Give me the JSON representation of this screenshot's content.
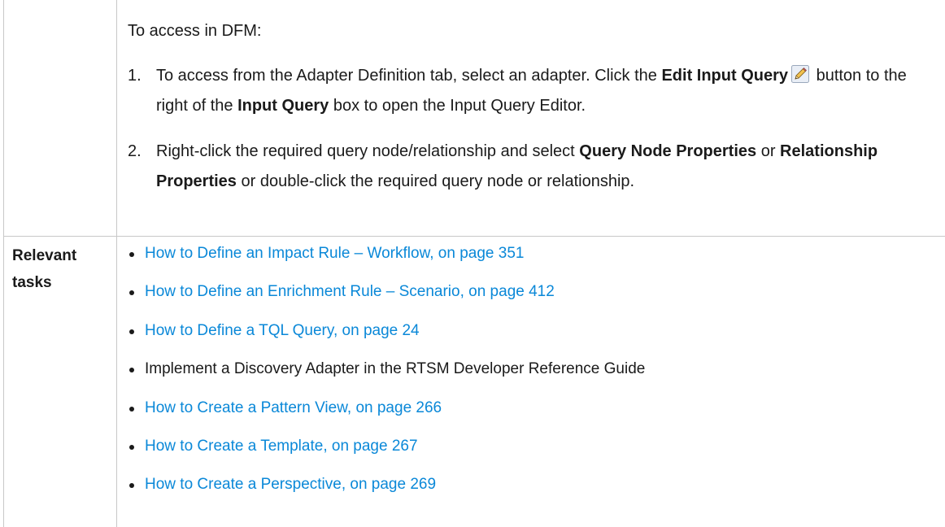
{
  "row_access": {
    "intro": "To access in DFM:",
    "steps": [
      {
        "number": "1.",
        "part1": "To access from the Adapter Definition tab, select an adapter. Click the ",
        "bold1": "Edit Input Query",
        "part2": " button to the right of the ",
        "bold2": "Input Query",
        "part3": " box to open the Input Query Editor."
      },
      {
        "number": "2.",
        "part1": "Right-click the required query node/relationship and select ",
        "bold1": "Query Node Properties",
        "part2": " or ",
        "bold2": "Relationship Properties",
        "part3": " or double-click the required query node or relationship."
      }
    ],
    "icon": "pencil-icon"
  },
  "row_tasks": {
    "label_line1": "Relevant",
    "label_line2": "tasks",
    "items": [
      {
        "text": "How to Define an Impact Rule – Workflow, on page 351",
        "is_link": true
      },
      {
        "text": "How to Define an Enrichment Rule – Scenario, on page 412",
        "is_link": true
      },
      {
        "text": "How to Define a TQL Query, on page 24",
        "is_link": true
      },
      {
        "text": "Implement a Discovery Adapter in the RTSM Developer Reference Guide",
        "is_link": false
      },
      {
        "text": "How to Create a Pattern View, on page 266",
        "is_link": true
      },
      {
        "text": "How to Create a Template, on page 267",
        "is_link": true
      },
      {
        "text": "How to Create a Perspective, on page 269",
        "is_link": true
      }
    ]
  },
  "colors": {
    "link": "#0a88d8",
    "text": "#1a1a1a",
    "border": "#c8c8c8"
  }
}
